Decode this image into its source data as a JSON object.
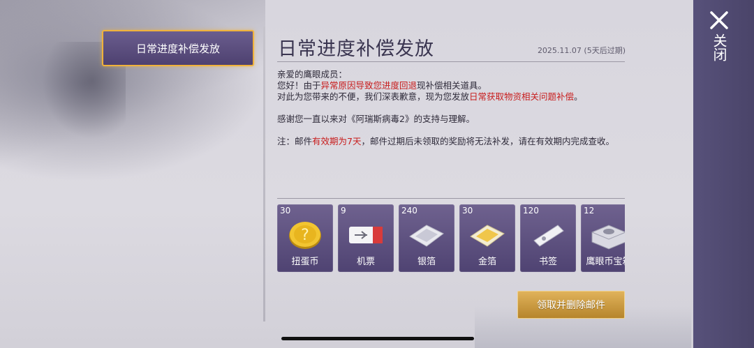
{
  "tab": {
    "label": "日常进度补偿发放"
  },
  "mail": {
    "title": "日常进度补偿发放",
    "date": "2025.11.07 (5天后过期)",
    "greeting": "亲爱的鹰眼成员：",
    "line2_a": "您好！由于",
    "line2_red": "异常原因导致您进度回退",
    "line2_b": "现补偿相关道具。",
    "line3_a": "对此为您带来的不便，我们深表歉意，现为您发放",
    "line3_red": "日常获取物资相关问题补偿",
    "line3_b": "。",
    "thanks": "感谢您一直以来对《阿瑞斯病毒2》的支持与理解。",
    "note_a": "注：邮件",
    "note_red": "有效期为7天",
    "note_b": "，邮件过期后未领取的奖励将无法补发，请在有效期内完成查收。"
  },
  "items": [
    {
      "count": "30",
      "name": "扭蛋币",
      "icon": "gold-coin-icon"
    },
    {
      "count": "9",
      "name": "机票",
      "icon": "ticket-icon"
    },
    {
      "count": "240",
      "name": "银箔",
      "icon": "silver-foil-icon"
    },
    {
      "count": "30",
      "name": "金箔",
      "icon": "gold-foil-icon"
    },
    {
      "count": "120",
      "name": "书签",
      "icon": "bookmark-icon"
    },
    {
      "count": "12",
      "name": "鹰眼币宝箱",
      "icon": "treasure-chest-icon"
    }
  ],
  "claim_button": {
    "label": "领取并删除邮件"
  },
  "close": {
    "label": "关闭"
  },
  "colors": {
    "accent_gold": "#f0b23b",
    "panel_purple": "#5a4e7e",
    "highlight_red": "#c81d1d"
  }
}
